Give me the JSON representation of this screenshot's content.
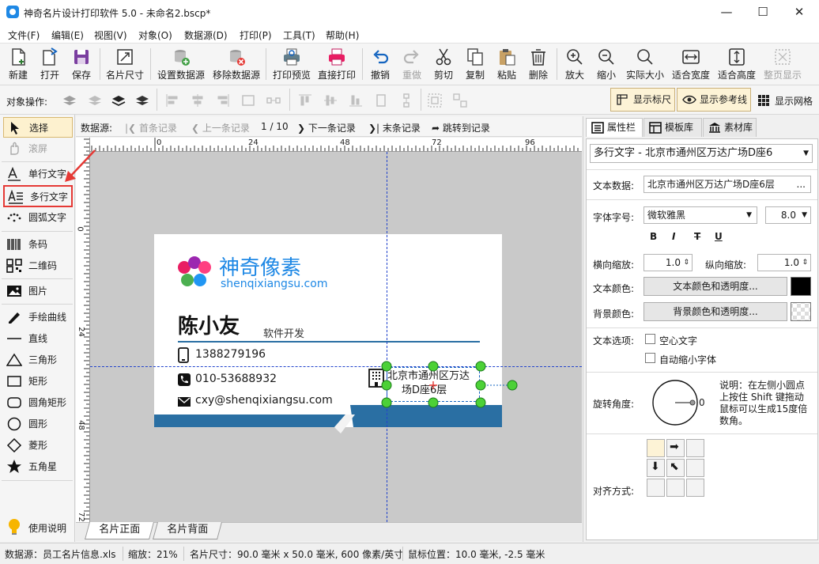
{
  "window": {
    "title": "神奇名片设计打印软件 5.0 - 未命名2.bscp*",
    "minimize": "—",
    "maximize": "☐",
    "close": "✕"
  },
  "menu": [
    "文件(F)",
    "编辑(E)",
    "视图(V)",
    "对象(O)",
    "数据源(D)",
    "打印(P)",
    "工具(T)",
    "帮助(H)"
  ],
  "toolbar": {
    "new": "新建",
    "open": "打开",
    "save": "保存",
    "card_size": "名片尺寸",
    "set_datasource": "设置数据源",
    "remove_datasource": "移除数据源",
    "print_preview": "打印预览",
    "direct_print": "直接打印",
    "undo": "撤销",
    "redo": "重做",
    "cut": "剪切",
    "copy": "复制",
    "paste": "粘贴",
    "delete": "删除",
    "zoom_in": "放大",
    "zoom_out": "缩小",
    "actual_size": "实际大小",
    "fit_width": "适合宽度",
    "fit_height": "适合高度",
    "fit_page": "整页显示"
  },
  "objbar": {
    "label": "对象操作:",
    "show_ruler": "显示标尺",
    "show_guides": "显示参考线",
    "show_grid": "显示网格"
  },
  "left_tools": {
    "select": "选择",
    "scroll": "滚屏",
    "single_text": "单行文字",
    "multi_text": "多行文字",
    "arc_text": "圆弧文字",
    "barcode": "条码",
    "qrcode": "二维码",
    "image": "图片",
    "freehand": "手绘曲线",
    "line": "直线",
    "triangle": "三角形",
    "rectangle": "矩形",
    "rounded_rect": "圆角矩形",
    "circle": "圆形",
    "diamond": "菱形",
    "star": "五角星",
    "help": "使用说明"
  },
  "navbar": {
    "label": "数据源:",
    "first": "首条记录",
    "prev": "上一条记录",
    "position": "1 / 10",
    "next": "下一条记录",
    "last": "末条记录",
    "goto": "跳转到记录"
  },
  "ruler": {
    "h_ticks": [
      "0",
      "24",
      "48",
      "72",
      "96"
    ],
    "v_ticks": [
      "0",
      "24",
      "48",
      "72"
    ]
  },
  "card": {
    "brand_cn": "神奇像素",
    "brand_en": "shenqixiangsu.com",
    "name": "陈小友",
    "job": "软件开发",
    "phone": "1388279196",
    "tel": "010-53688932",
    "email": "cxy@shenqixiangsu.com",
    "address_line1": "北京市通州区万达",
    "address_line2": "场D座6层",
    "colors": {
      "blue": "#2a6fa3",
      "accent_text": "#1e88e5"
    }
  },
  "page_tabs": {
    "front": "名片正面",
    "back": "名片背面"
  },
  "right_panel": {
    "tabs": {
      "properties": "属性栏",
      "templates": "模板库",
      "assets": "素材库"
    },
    "object_selector": "多行文字 - 北京市通州区万达广场D座6",
    "text_data_label": "文本数据:",
    "text_data_value": "北京市通州区万达广场D座6层",
    "text_data_more": "...",
    "font_label": "字体字号:",
    "font_value": "微软雅黑",
    "font_size": "8.0",
    "bold": "B",
    "italic": "I",
    "strike": "T",
    "underline": "U",
    "hscale_label": "横向缩放:",
    "hscale_value": "1.0",
    "vscale_label": "纵向缩放:",
    "vscale_value": "1.0",
    "text_color_label": "文本颜色:",
    "text_color_button": "文本颜色和透明度...",
    "bg_color_label": "背景颜色:",
    "bg_color_button": "背景颜色和透明度...",
    "text_options_label": "文本选项:",
    "hollow_text": "空心文字",
    "auto_shrink": "自动缩小字体",
    "rotation_label": "旋转角度:",
    "rotation_value": "0",
    "rotation_note": "说明：在左侧小圆点上按住 Shift 键拖动鼠标可以生成15度倍数角。",
    "align_label": "对齐方式:"
  },
  "status": {
    "datasource": "数据源：员工名片信息.xls",
    "zoom": "缩放：21%",
    "card_size": "名片尺寸：90.0 毫米 x 50.0 毫米, 600 像素/英寸",
    "mouse_pos": "鼠标位置：10.0 毫米, -2.5 毫米"
  }
}
